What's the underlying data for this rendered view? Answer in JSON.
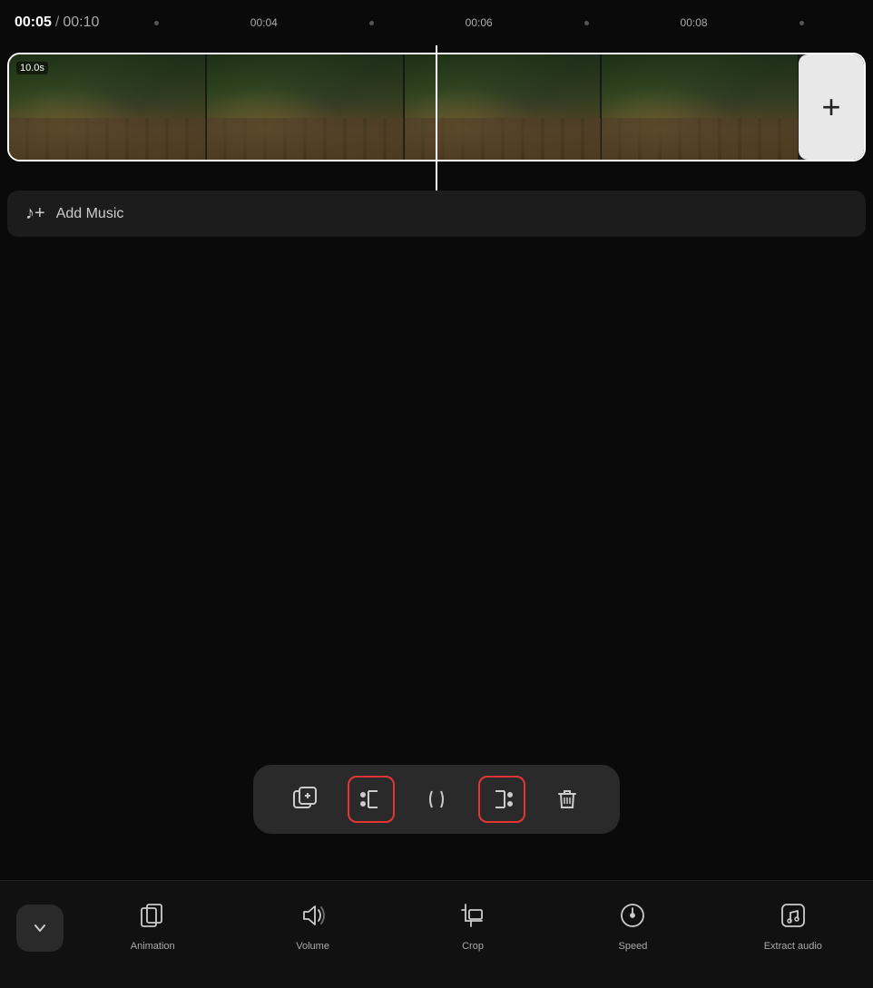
{
  "timeline": {
    "current_time": "00:05",
    "total_time": "00:10",
    "separator": "/",
    "markers": [
      "00:04",
      "00:06",
      "00:08"
    ],
    "duration_badge": "10.0s"
  },
  "add_music": {
    "label": "Add Music",
    "icon": "music-note-icon"
  },
  "trim_toolbar": {
    "tools": [
      {
        "id": "copy",
        "icon": "copy-plus-icon",
        "label": "Copy",
        "highlighted": false
      },
      {
        "id": "trim-left",
        "icon": "trim-left-icon",
        "label": "Trim Left",
        "highlighted": true
      },
      {
        "id": "split",
        "icon": "split-icon",
        "label": "Split",
        "highlighted": false
      },
      {
        "id": "trim-right",
        "icon": "trim-right-icon",
        "label": "Trim Right",
        "highlighted": true
      },
      {
        "id": "delete",
        "icon": "delete-icon",
        "label": "Delete",
        "highlighted": false
      }
    ]
  },
  "bottom_toolbar": {
    "chevron": "chevron-down-icon",
    "tools": [
      {
        "id": "animation",
        "icon": "animation-icon",
        "label": "Animation"
      },
      {
        "id": "volume",
        "icon": "volume-icon",
        "label": "Volume"
      },
      {
        "id": "crop",
        "icon": "crop-icon",
        "label": "Crop"
      },
      {
        "id": "speed",
        "icon": "speed-icon",
        "label": "Speed"
      },
      {
        "id": "extract-audio",
        "icon": "extract-audio-icon",
        "label": "Extract audio"
      }
    ]
  },
  "add_clip": {
    "label": "+"
  }
}
